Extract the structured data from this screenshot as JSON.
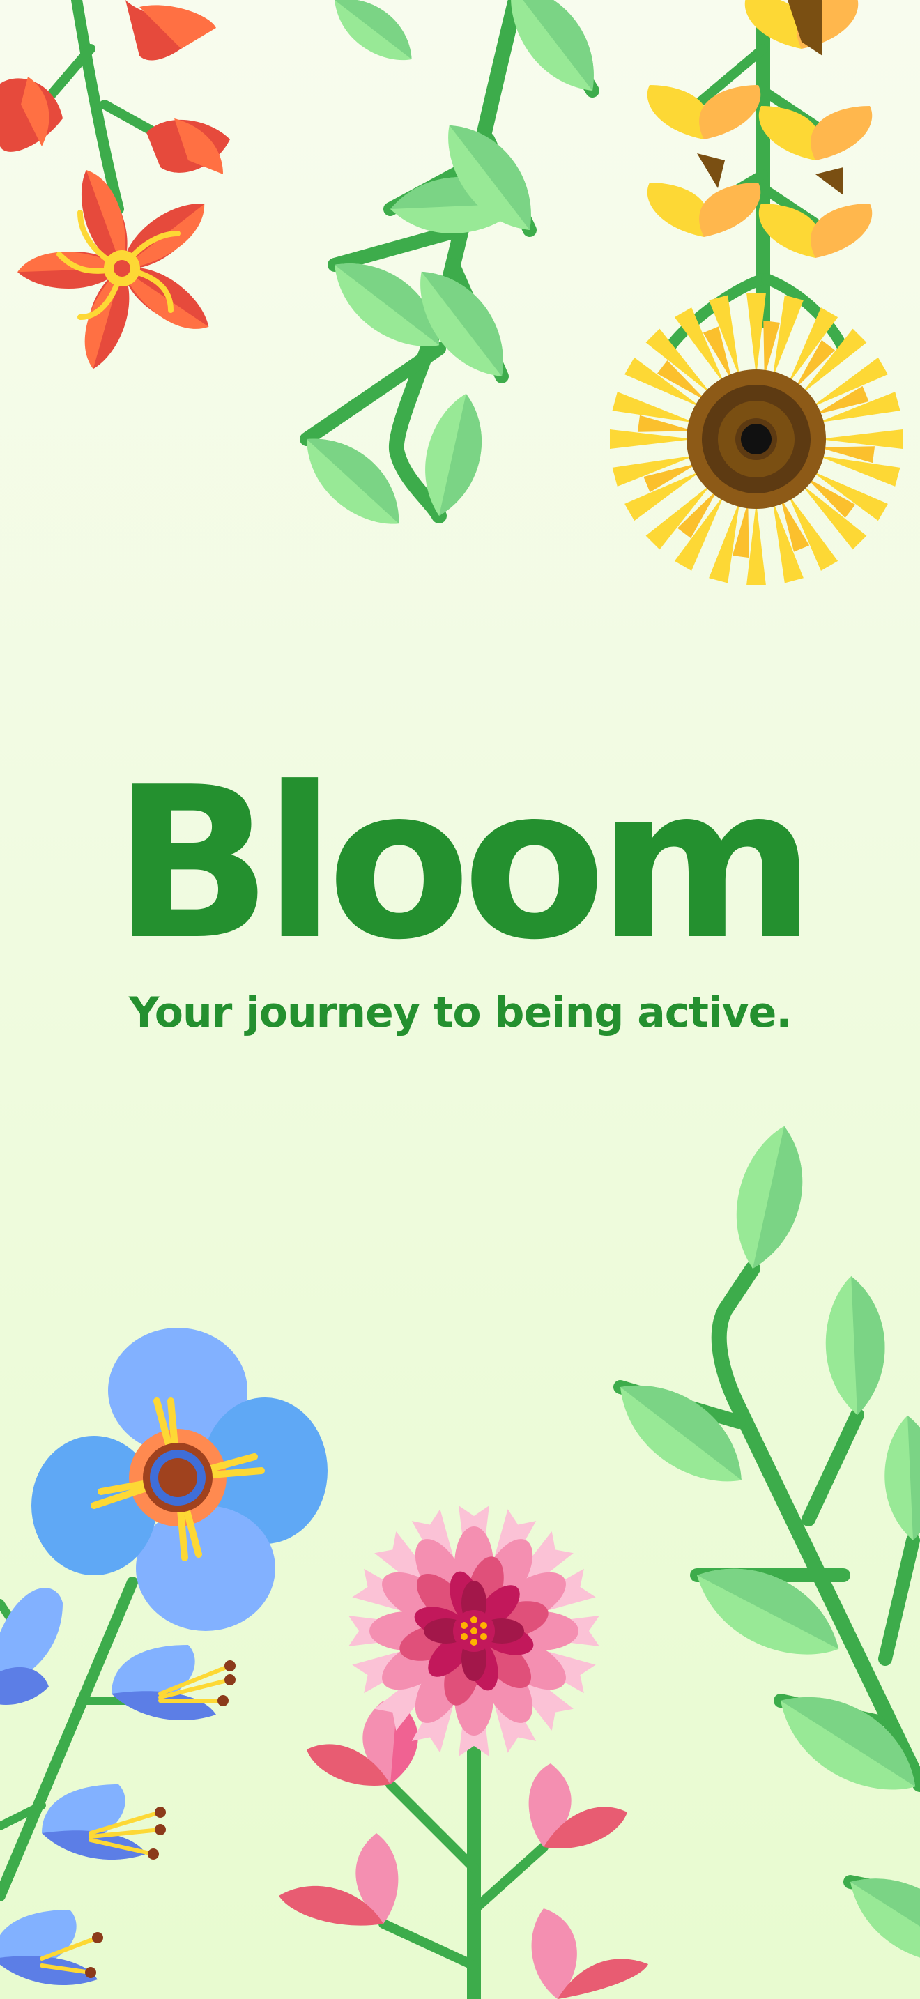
{
  "app": {
    "title": "Bloom",
    "tagline": "Your journey to being active."
  },
  "colors": {
    "background": "#f1fbe2",
    "brand_green": "#24902f",
    "stem_green": "#3dac4b",
    "leaf_light": "#98e996",
    "leaf_dark": "#7bd485",
    "sunflower_petal": "#fdd835",
    "sunflower_center": "#5d3a12",
    "red_flower": "#e64a3c",
    "blue_flower": "#5fa8f5",
    "pink_flower": "#f06292"
  },
  "illustrations": [
    "red-flower-icon",
    "sunflower-icon",
    "yellow-blossom-icon",
    "green-leaves-icon",
    "blue-flower-icon",
    "pink-dahlia-icon",
    "pink-tulip-icon",
    "blue-bellflower-icon"
  ]
}
